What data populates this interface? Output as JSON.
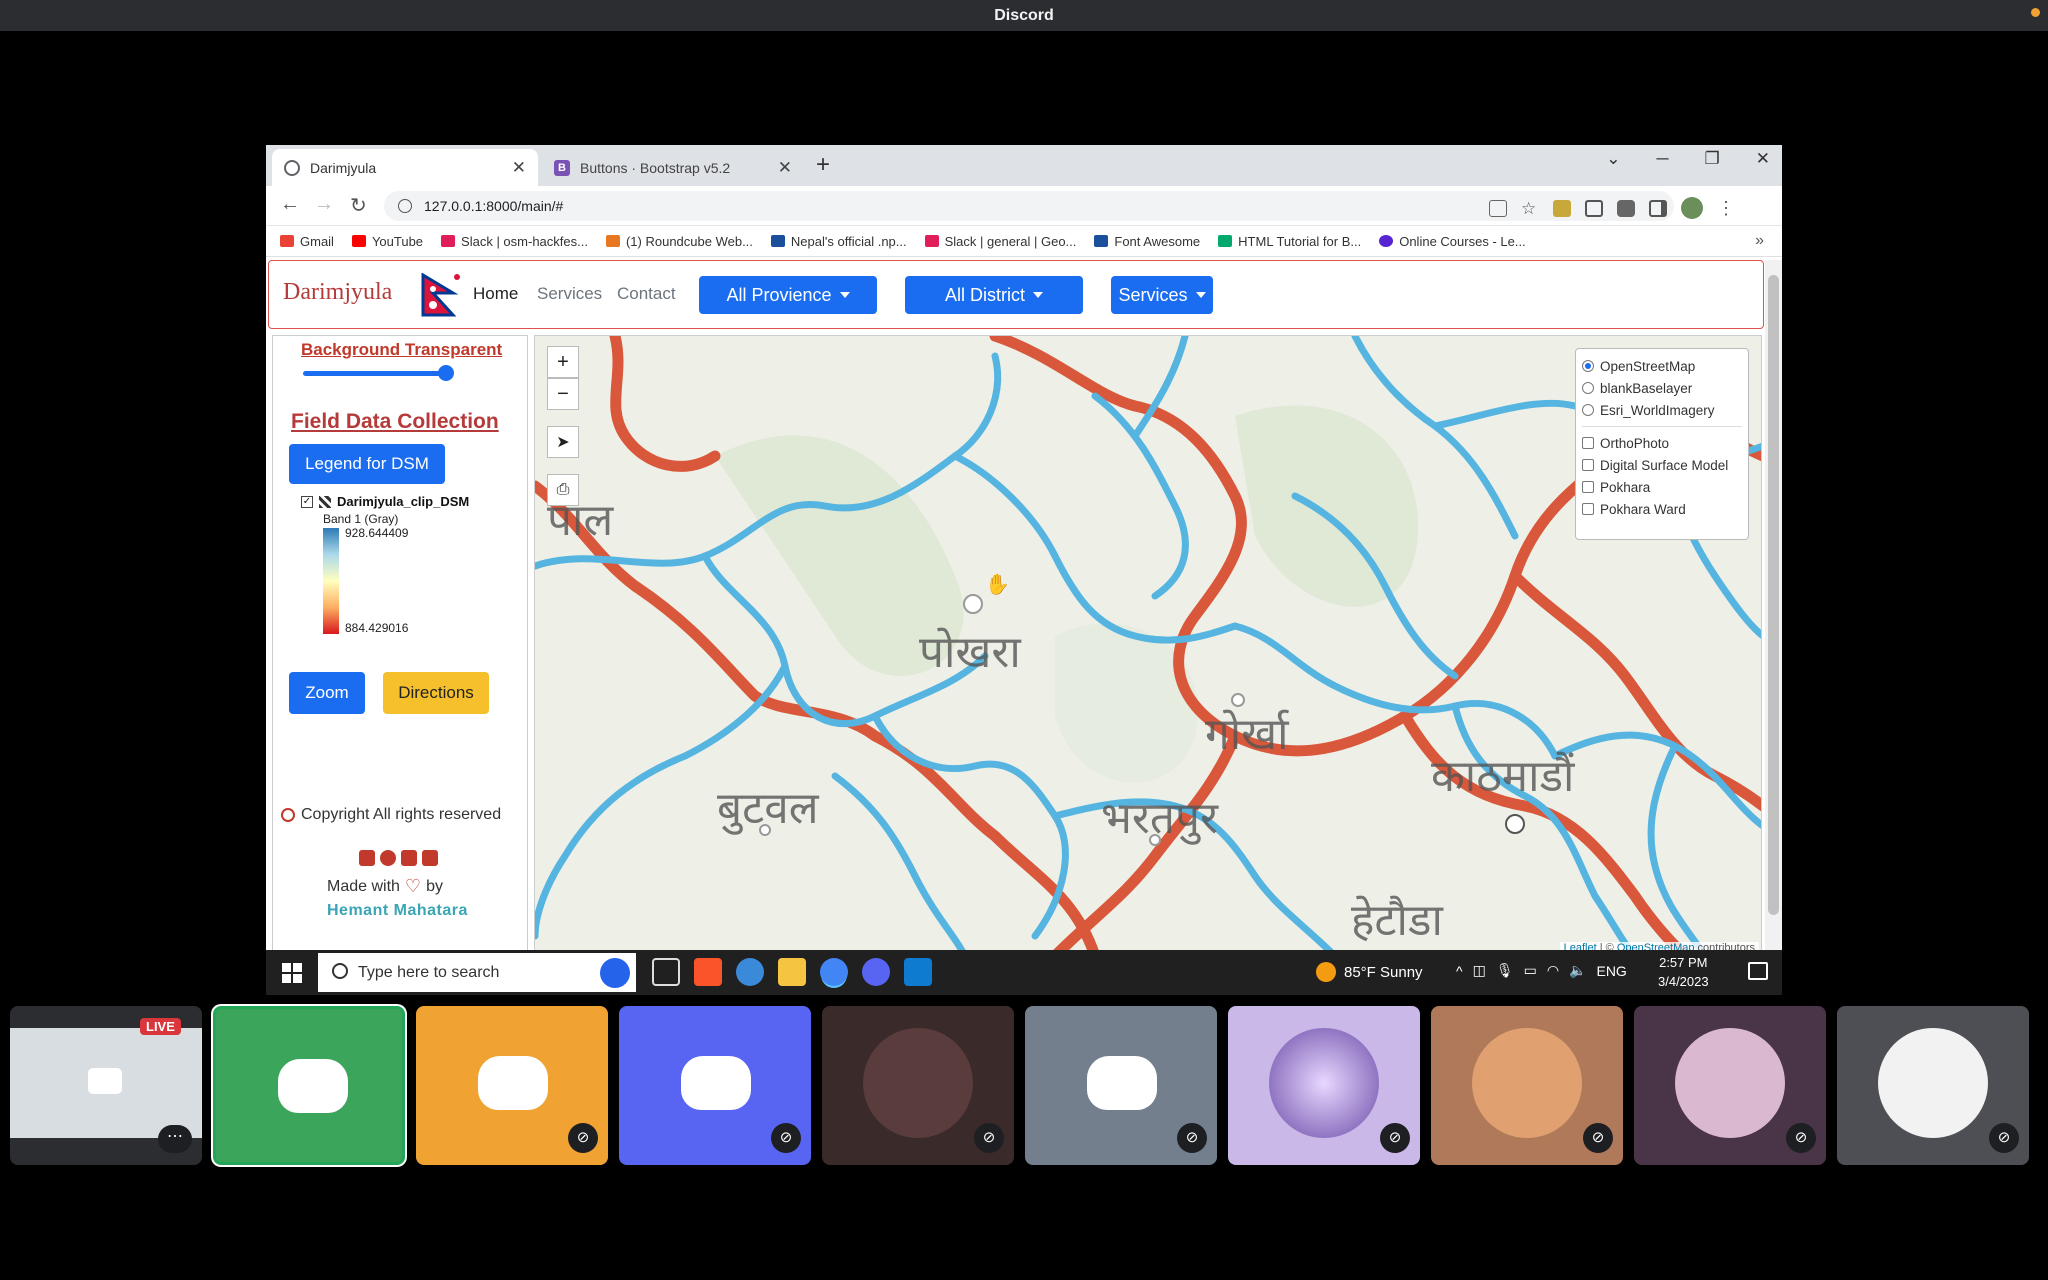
{
  "app": {
    "title": "Discord"
  },
  "browser": {
    "tabs": [
      {
        "title": "Darimjyula"
      },
      {
        "title": "Buttons · Bootstrap v5.2"
      }
    ],
    "url": "127.0.0.1:8000/main/#",
    "bookmarks": [
      {
        "label": "Gmail",
        "color": "#ea4335"
      },
      {
        "label": "YouTube",
        "color": "#ff0000"
      },
      {
        "label": "Slack | osm-hackfes...",
        "color": "#4a154b"
      },
      {
        "label": "(1) Roundcube Web...",
        "color": "#e87722"
      },
      {
        "label": "Nepal's official .np...",
        "color": "#1b4f9c"
      },
      {
        "label": "Slack | general | Geo...",
        "color": "#4a154b"
      },
      {
        "label": "Font Awesome",
        "color": "#1c4f9c"
      },
      {
        "label": "HTML Tutorial for B...",
        "color": "#04aa6d"
      },
      {
        "label": "Online Courses - Le...",
        "color": "#5624d0"
      }
    ]
  },
  "site": {
    "brand": "Darimjyula",
    "nav": {
      "home": "Home",
      "services": "Services",
      "contact": "Contact"
    },
    "dropdowns": {
      "province": "All Provience",
      "district": "All District",
      "services": "Services"
    }
  },
  "panel": {
    "bg_label": "Background Transparent",
    "opacity_value": 0.9,
    "field_title": "Field Data Collection",
    "legend_button": "Legend for DSM",
    "layer_name": "Darimjyula_clip_DSM",
    "band": "Band 1 (Gray)",
    "max_value": "928.644409",
    "min_value": "884.429016",
    "zoom_button": "Zoom",
    "directions_button": "Directions",
    "copyright": "Copyright All rights reserved",
    "made_with": "Made with",
    "by": "by",
    "author": "Hemant Mahatara"
  },
  "map": {
    "controls": {
      "zoom_in": "+",
      "zoom_out": "−"
    },
    "base_layers": [
      "OpenStreetMap",
      "blankBaselayer",
      "Esri_WorldImagery"
    ],
    "selected_base": "OpenStreetMap",
    "overlays": [
      "OrthoPhoto",
      "Digital Surface Model",
      "Pokhara",
      "Pokhara Ward"
    ],
    "place_labels": [
      "पाल",
      "पोखरा",
      "गोर्खा",
      "बुटवल",
      "भरतपुर",
      "काठमाडौं",
      "हेटौडा"
    ],
    "attribution": {
      "leaflet": "Leaflet",
      "sep": " | © ",
      "osm": "OpenStreetMap",
      "suffix": " contributors"
    }
  },
  "taskbar": {
    "search_placeholder": "Type here to search",
    "weather": "85°F  Sunny",
    "lang": "ENG",
    "time": "2:57 PM",
    "date": "3/4/2023"
  },
  "participants": {
    "live_badge": "LIVE",
    "tiles": [
      {
        "kind": "stream",
        "color": "#2b2d31"
      },
      {
        "kind": "discord",
        "color": "#3ba55c",
        "speaking": true
      },
      {
        "kind": "discord",
        "color": "#f0a232"
      },
      {
        "kind": "discord",
        "color": "#5865f2"
      },
      {
        "kind": "avatar",
        "color": "#3a2a2a"
      },
      {
        "kind": "discord",
        "color": "#747f8d"
      },
      {
        "kind": "avatar",
        "color": "#c9b8e8"
      },
      {
        "kind": "avatar",
        "color": "#b07a5a"
      },
      {
        "kind": "avatar",
        "color": "#4a3448"
      },
      {
        "kind": "avatar",
        "color": "#4d4f55"
      }
    ]
  }
}
